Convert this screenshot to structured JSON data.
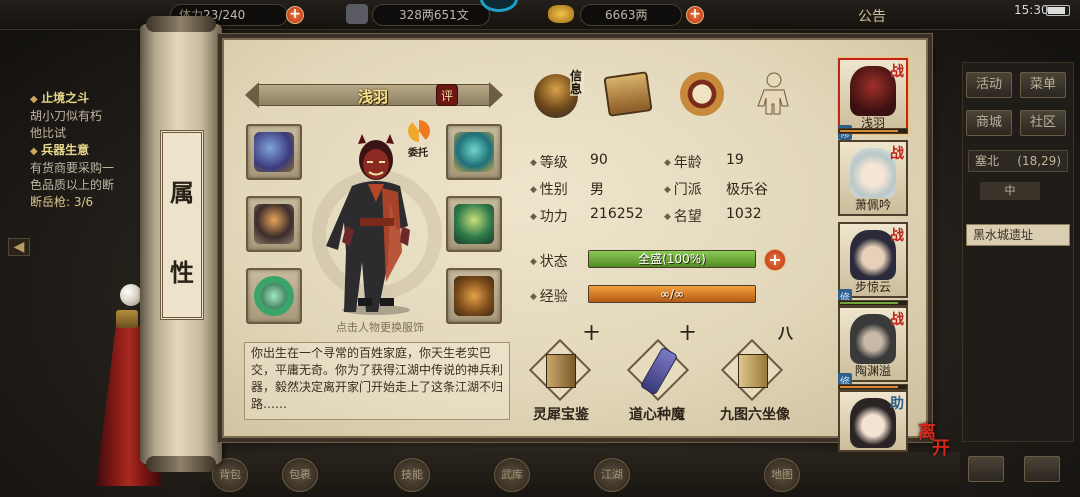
{
  "topbar": {
    "stamina_label": "体力",
    "stamina_value": "23/240",
    "money_value": "328两651文",
    "gold_value": "6663两",
    "notice_label": "公告",
    "clock": "15:30"
  },
  "quest": [
    {
      "title": "止境之斗",
      "desc": "胡小刀似有朽",
      "desc2": "他比试"
    },
    {
      "title": "兵器生意",
      "desc": "有货商要采购一",
      "desc2": "色品质以上的断",
      "progress": "断岳枪: 3/6"
    }
  ],
  "side_menu": {
    "buttons": [
      "活动",
      "菜单",
      "商城",
      "社区"
    ],
    "region": "塞北",
    "region_coord": "(18,29)",
    "region_sub": "中",
    "map_name": "黑水城遗址"
  },
  "scroll_tab": {
    "char1": "属",
    "char2": "性"
  },
  "hero": {
    "name": "浅羽",
    "rate_label": "评",
    "entrust_label": "委托",
    "change_outfit_hint": "点击人物更换服饰",
    "bio": "你出生在一个寻常的百姓家庭，你天生老实巴交，平庸无奇。你为了获得江湖中传说的神兵利器，毅然决定离开家门开始走上了这条江湖不归路……"
  },
  "equipment_slots": [
    "gauntlet-icon",
    "claw-icon",
    "ring-icon",
    "helmet-icon",
    "armor-icon",
    "boots-icon"
  ],
  "top_icons": [
    {
      "name": "信息",
      "icon": "straw-hat-icon"
    },
    {
      "name": "",
      "icon": "bag-icon"
    },
    {
      "name": "",
      "icon": "bagua-icon"
    },
    {
      "name": "",
      "icon": "meridian-figure-icon"
    }
  ],
  "stats": {
    "level_label": "等级",
    "level": "90",
    "age_label": "年龄",
    "age": "19",
    "gender_label": "性别",
    "gender": "男",
    "sect_label": "门派",
    "sect": "极乐谷",
    "power_label": "功力",
    "power": "216252",
    "fame_label": "名望",
    "fame": "1032",
    "state_label": "状态",
    "state_value": "全盛(100%)",
    "state_fraction": 1.0,
    "exp_label": "经验",
    "exp_value": "∞/∞"
  },
  "books": [
    {
      "title": "灵犀宝鉴",
      "level": "十"
    },
    {
      "title": "道心种魔",
      "level": "十"
    },
    {
      "title": "九图六坐像",
      "level": "八"
    }
  ],
  "party": [
    {
      "name": "浅羽",
      "tag": "战",
      "selected": true
    },
    {
      "name": "萧佩吟",
      "tag": "战"
    },
    {
      "name": "步惊云",
      "tag": "战"
    },
    {
      "name": "陶渊溢",
      "tag": "战"
    },
    {
      "name": "",
      "tag": "助"
    }
  ],
  "party_level_tag": "修",
  "leave_label": "离开",
  "bottom_nav": [
    "背包",
    "包裹",
    "技能",
    "武库",
    "江湖",
    "地图"
  ],
  "colors": {
    "state_bar": "#6da23a",
    "exp_bar": "#d9791f",
    "accent_red": "#c0241b",
    "name_gold": "#f6e58c"
  }
}
